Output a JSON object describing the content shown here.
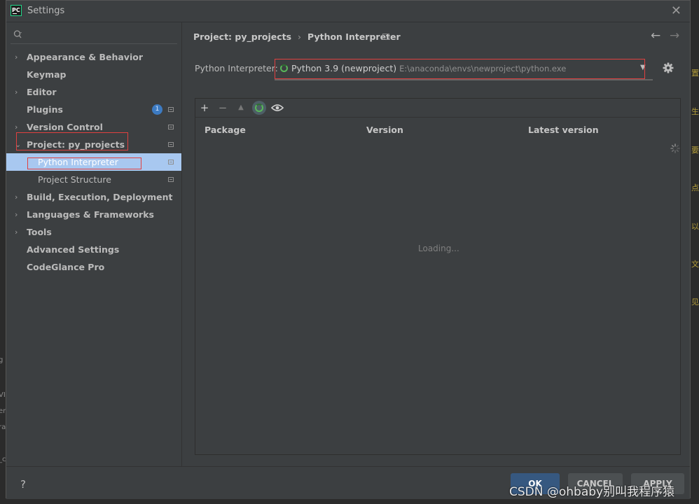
{
  "window": {
    "title": "Settings",
    "app_icon_text": "PC"
  },
  "search": {
    "placeholder": ""
  },
  "sidebar": {
    "items": [
      {
        "label": "Appearance & Behavior",
        "chevron": "›"
      },
      {
        "label": "Keymap"
      },
      {
        "label": "Editor",
        "chevron": "›"
      },
      {
        "label": "Plugins",
        "badge": "1"
      },
      {
        "label": "Version Control",
        "chevron": "›"
      },
      {
        "label": "Project: py_projects",
        "chevron": "⌄"
      },
      {
        "label": "Python Interpreter"
      },
      {
        "label": "Project Structure"
      },
      {
        "label": "Build, Execution, Deployment",
        "chevron": "›"
      },
      {
        "label": "Languages & Frameworks",
        "chevron": "›"
      },
      {
        "label": "Tools",
        "chevron": "›"
      },
      {
        "label": "Advanced Settings"
      },
      {
        "label": "CodeGlance Pro"
      }
    ]
  },
  "breadcrumb": {
    "parent": "Project: py_projects",
    "separator": "›",
    "current": "Python Interpreter"
  },
  "nav": {
    "back": "←",
    "forward": "→"
  },
  "interpreter": {
    "label": "Python Interpreter:",
    "name": "Python 3.9 (newproject)",
    "path": "E:\\anaconda\\envs\\newproject\\python.exe"
  },
  "packages": {
    "toolbar": {
      "add": "+",
      "remove": "−",
      "upgrade": "▲"
    },
    "columns": [
      "Package",
      "Version",
      "Latest version"
    ],
    "loading": "Loading..."
  },
  "footer": {
    "help": "?",
    "ok": "OK",
    "cancel": "CANCEL",
    "apply": "APPLY"
  },
  "watermark": "CSDN @ohbaby别叫我程序猿",
  "colors": {
    "accent": "#365880",
    "selection": "#a8c8f0",
    "highlight_box": "#e04040",
    "spinner": "#58b85a"
  }
}
